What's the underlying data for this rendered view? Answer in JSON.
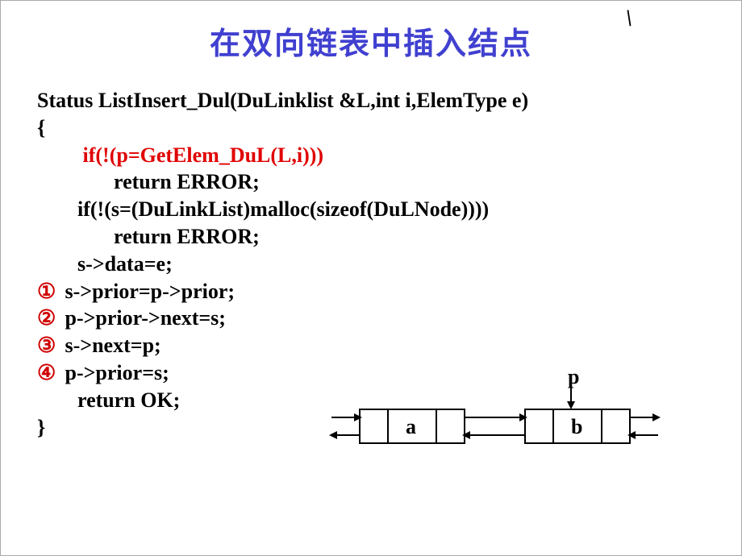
{
  "title": "在双向链表中插入结点",
  "decoration": "\\",
  "code": {
    "line1": "Status ListInsert_Dul(DuLinklist &L,int i,ElemType e)",
    "line2": "{",
    "line3": " if(!(p=GetElem_DuL(L,i)))",
    "line4": "return ERROR;",
    "line5": "if(!(s=(DuLinkList)malloc(sizeof(DuLNode))))",
    "line6": "return ERROR;",
    "line7": "s->data=e;",
    "marker1": "①",
    "step1": " s->prior=p->prior;",
    "marker2": "②",
    "step2": " p->prior->next=s;",
    "marker3": "③",
    "step3": " s->next=p;",
    "marker4": "④",
    "step4": " p->prior=s;",
    "line12": "return OK;",
    "line13": "}"
  },
  "diagram": {
    "pointer": "p",
    "nodeA": "a",
    "nodeB": "b"
  }
}
